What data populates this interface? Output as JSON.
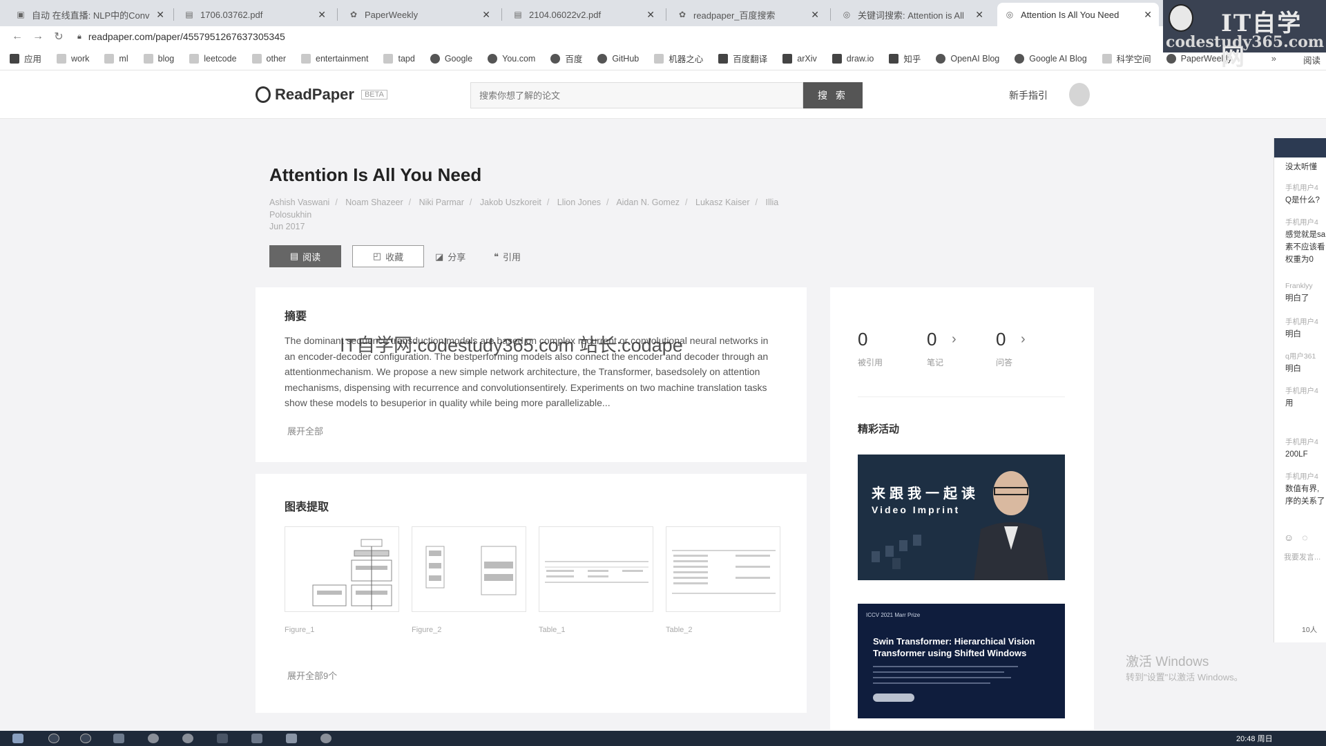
{
  "browser": {
    "tabs": [
      {
        "title": "自动 在线直播: NLP中的Conv"
      },
      {
        "title": "1706.03762.pdf"
      },
      {
        "title": "PaperWeekly"
      },
      {
        "title": "2104.06022v2.pdf"
      },
      {
        "title": "readpaper_百度搜索"
      },
      {
        "title": "关键词搜索: Attention is All"
      },
      {
        "title": "Attention Is All You Need"
      }
    ],
    "url": "readpaper.com/paper/4557951267637305345",
    "bookmarks": [
      "应用",
      "work",
      "ml",
      "blog",
      "leetcode",
      "other",
      "entertainment",
      "tapd",
      "Google",
      "You.com",
      "百度",
      "GitHub",
      "机器之心",
      "百度翻译",
      "arXiv",
      "draw.io",
      "知乎",
      "OpenAI Blog",
      "Google AI Blog",
      "科学空间",
      "PaperWeekly"
    ],
    "bookmarks_more": "»",
    "reading_list": "阅读"
  },
  "site_watermark": {
    "title": "IT自学网",
    "subtitle": "codestudy365.com"
  },
  "header": {
    "logo": "ReadPaper",
    "beta": "BETA",
    "search_placeholder": "搜索你想了解的论文",
    "search_button": "搜 索",
    "guide": "新手指引"
  },
  "paper": {
    "title": "Attention Is All You Need",
    "authors": [
      "Ashish Vaswani",
      "Noam Shazeer",
      "Niki Parmar",
      "Jakob Uszkoreit",
      "Llion Jones",
      "Aidan N. Gomez",
      "Lukasz Kaiser",
      "Illia Polosukhin"
    ],
    "date": "Jun 2017",
    "actions": {
      "read": "阅读",
      "favorite": "收藏",
      "share": "分享",
      "cite": "引用"
    }
  },
  "abstract": {
    "heading": "摘要",
    "text": "The dominant sequence transduction models are based on complex recurrent or convolutional neural networks in an encoder-decoder configuration. The bestperforming models also connect the encoder and decoder through an attentionmechanism. We propose a new simple network architecture, the Transformer, basedsolely on attention mechanisms, dispensing with recurrence and convolutionsentirely. Experiments on two machine translation tasks show these models to besuperior in quality while being more parallelizable...",
    "expand": "展开全部"
  },
  "overlay_watermark": "IT自学网:codestudy365.com 站长:codape",
  "figures": {
    "heading": "图表提取",
    "items": [
      {
        "label": "Figure_1"
      },
      {
        "label": "Figure_2"
      },
      {
        "label": "Table_1"
      },
      {
        "label": "Table_2"
      }
    ],
    "expand": "展开全部9个"
  },
  "stats": [
    {
      "value": "0",
      "label": "被引用"
    },
    {
      "value": "0",
      "label": "笔记"
    },
    {
      "value": "0",
      "label": "问答"
    }
  ],
  "activities": {
    "heading": "精彩活动",
    "banner1": {
      "title": "来跟我一起读",
      "subtitle": "Video Imprint"
    },
    "banner2": {
      "top": "ICCV 2021  Marr Prize",
      "title": "Swin Transformer: Hierarchical Vision Transformer using Shifted Windows"
    }
  },
  "chat": {
    "messages": [
      {
        "name": "",
        "text": "没太听懂"
      },
      {
        "name": "手机用户4",
        "text": "Q是什么?"
      },
      {
        "name": "手机用户4",
        "text": "感觉就是sa"
      },
      {
        "name": "",
        "text": "素不应该看"
      },
      {
        "name": "",
        "text": "权重为0"
      },
      {
        "name": "Franklyy",
        "text": "明白了"
      },
      {
        "name": "手机用户4",
        "text": "明白"
      },
      {
        "name": "q用户361",
        "text": "明白"
      },
      {
        "name": "手机用户4",
        "text": "用"
      },
      {
        "name": "手机用户4",
        "text": "200LF"
      },
      {
        "name": "手机用户4",
        "text": "数值有界,"
      },
      {
        "name": "",
        "text": "序的关系了"
      }
    ],
    "input_placeholder": "我要发言...",
    "count": "10人"
  },
  "windows": {
    "activate": "激活 Windows",
    "activate_sub": "转到\"设置\"以激活 Windows。",
    "time": "20:48 周日"
  }
}
